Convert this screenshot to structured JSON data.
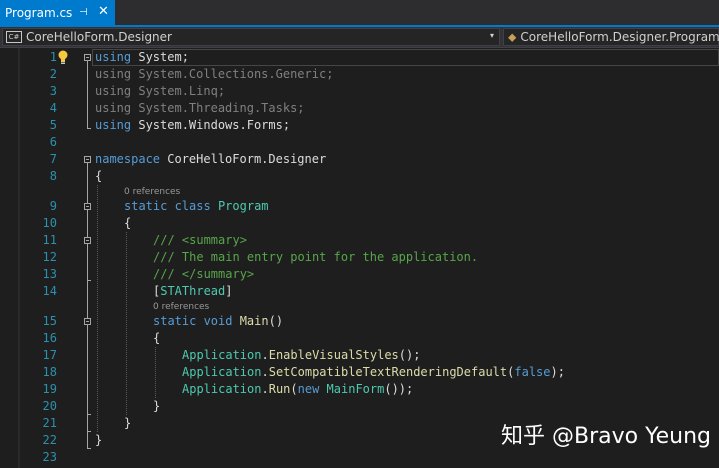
{
  "tab": {
    "label": "Program.cs",
    "pin_icon": "pin-icon",
    "close_icon": "close-icon"
  },
  "nav": {
    "project_icon_text": "C#",
    "project": "CoreHelloForm.Designer",
    "member": "CoreHelloForm.Designer.Program"
  },
  "codelens": {
    "ref1": "0 references",
    "ref2": "0 references"
  },
  "lines": [
    {
      "n": "1",
      "t1": "using",
      "t2": " System;"
    },
    {
      "n": "2",
      "t1": "using",
      "t2": " System.Collections.Generic;"
    },
    {
      "n": "3",
      "t1": "using",
      "t2": " System.Linq;"
    },
    {
      "n": "4",
      "t1": "using",
      "t2": " System.Threading.Tasks;"
    },
    {
      "n": "5",
      "t1": "using",
      "t2": " System.Windows.Forms;"
    },
    {
      "n": "6"
    },
    {
      "n": "7",
      "t1": "namespace",
      "t2": " CoreHelloForm.Designer"
    },
    {
      "n": "8",
      "t1": "{"
    },
    {
      "n": "9",
      "t1": "static",
      "t2": " class",
      "t3": " Program"
    },
    {
      "n": "10",
      "t1": "{"
    },
    {
      "n": "11",
      "t1": "/// <summary>"
    },
    {
      "n": "12",
      "t1": "/// The main entry point for the application."
    },
    {
      "n": "13",
      "t1": "/// </summary>"
    },
    {
      "n": "14",
      "t1": "[",
      "t2": "STAThread",
      "t3": "]"
    },
    {
      "n": "15",
      "t1": "static",
      "t2": " void",
      "t3": " Main",
      "t4": "()"
    },
    {
      "n": "16",
      "t1": "{"
    },
    {
      "n": "17",
      "t1": "Application",
      "t2": ".",
      "t3": "EnableVisualStyles",
      "t4": "();"
    },
    {
      "n": "18",
      "t1": "Application",
      "t2": ".",
      "t3": "SetCompatibleTextRenderingDefault",
      "t4": "(",
      "t5": "false",
      "t6": ");"
    },
    {
      "n": "19",
      "t1": "Application",
      "t2": ".",
      "t3": "Run",
      "t4": "(",
      "t5": "new",
      "t6": " MainForm",
      "t7": "());"
    },
    {
      "n": "20",
      "t1": "}"
    },
    {
      "n": "21",
      "t1": "}"
    },
    {
      "n": "22",
      "t1": "}"
    },
    {
      "n": "23"
    }
  ],
  "watermark": "知乎 @Bravo Yeung",
  "colors": {
    "accent": "#007acc",
    "keyword": "#569cd6",
    "type": "#4ec9b0",
    "method": "#dcdcaa",
    "comment": "#57a64a",
    "line_number": "#2b91af",
    "background": "#1e1e1e"
  }
}
